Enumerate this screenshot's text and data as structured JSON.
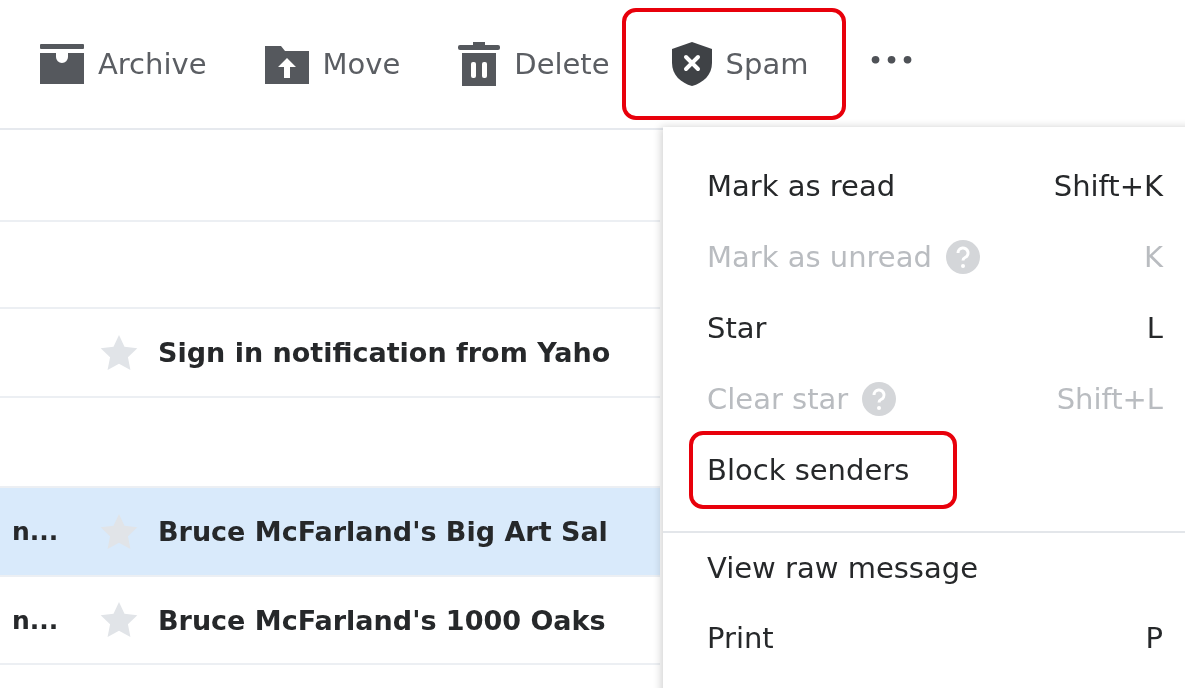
{
  "toolbar": [
    {
      "kind": "archive",
      "label": "Archive",
      "highlighted": false
    },
    {
      "kind": "move",
      "label": "Move",
      "highlighted": false
    },
    {
      "kind": "delete",
      "label": "Delete",
      "highlighted": false
    },
    {
      "kind": "spam",
      "label": "Spam",
      "highlighted": true
    },
    {
      "kind": "more",
      "label": "•••"
    }
  ],
  "messages": [
    {
      "kind": "empty",
      "selected": false
    },
    {
      "kind": "empty",
      "selected": false
    },
    {
      "kind": "message",
      "subject": "Sign in notification from Yaho",
      "starred": false,
      "selected": false
    },
    {
      "kind": "empty",
      "selected": false
    },
    {
      "kind": "message",
      "sender": "n...",
      "subject": "Bruce McFarland's Big Art Sal",
      "starred": false,
      "selected": true
    },
    {
      "kind": "message",
      "sender": "n...",
      "subject": "Bruce McFarland's 1000 Oaks",
      "starred": false,
      "selected": false
    }
  ],
  "menu": [
    {
      "label": "Mark as read",
      "shortcut": "Shift+K",
      "disabled": false,
      "help": false,
      "highlighted": false,
      "divider_before": false
    },
    {
      "label": "Mark as unread",
      "shortcut": "K",
      "disabled": true,
      "help": true,
      "highlighted": false,
      "divider_before": false
    },
    {
      "label": "Star",
      "shortcut": "L",
      "disabled": false,
      "help": false,
      "highlighted": false,
      "divider_before": false
    },
    {
      "label": "Clear star",
      "shortcut": "Shift+L",
      "disabled": true,
      "help": true,
      "highlighted": false,
      "divider_before": false
    },
    {
      "label": "Block senders",
      "disabled": false,
      "help": false,
      "highlighted": true,
      "divider_before": false
    },
    {
      "label": "View raw message",
      "disabled": false,
      "help": false,
      "highlighted": false,
      "divider_before": true
    },
    {
      "label": "Print",
      "shortcut": "P",
      "disabled": false,
      "help": false,
      "highlighted": false,
      "divider_before": false
    }
  ]
}
